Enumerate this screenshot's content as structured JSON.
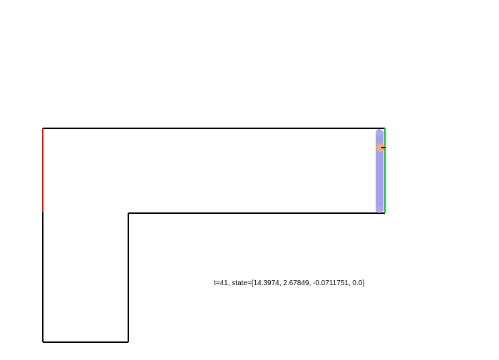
{
  "status": {
    "readout": "t=41, state=[14.3974, 2.67849, -0.0711751, 0.0]"
  },
  "scene": {
    "colors": {
      "background": "#ffffff",
      "wall": "#000000",
      "start_line": "#ff0000",
      "goal_line": "#00cc00",
      "trail": "#9090f0",
      "agent": "#f4a582",
      "heading": "#000000",
      "text": "#000000"
    }
  }
}
